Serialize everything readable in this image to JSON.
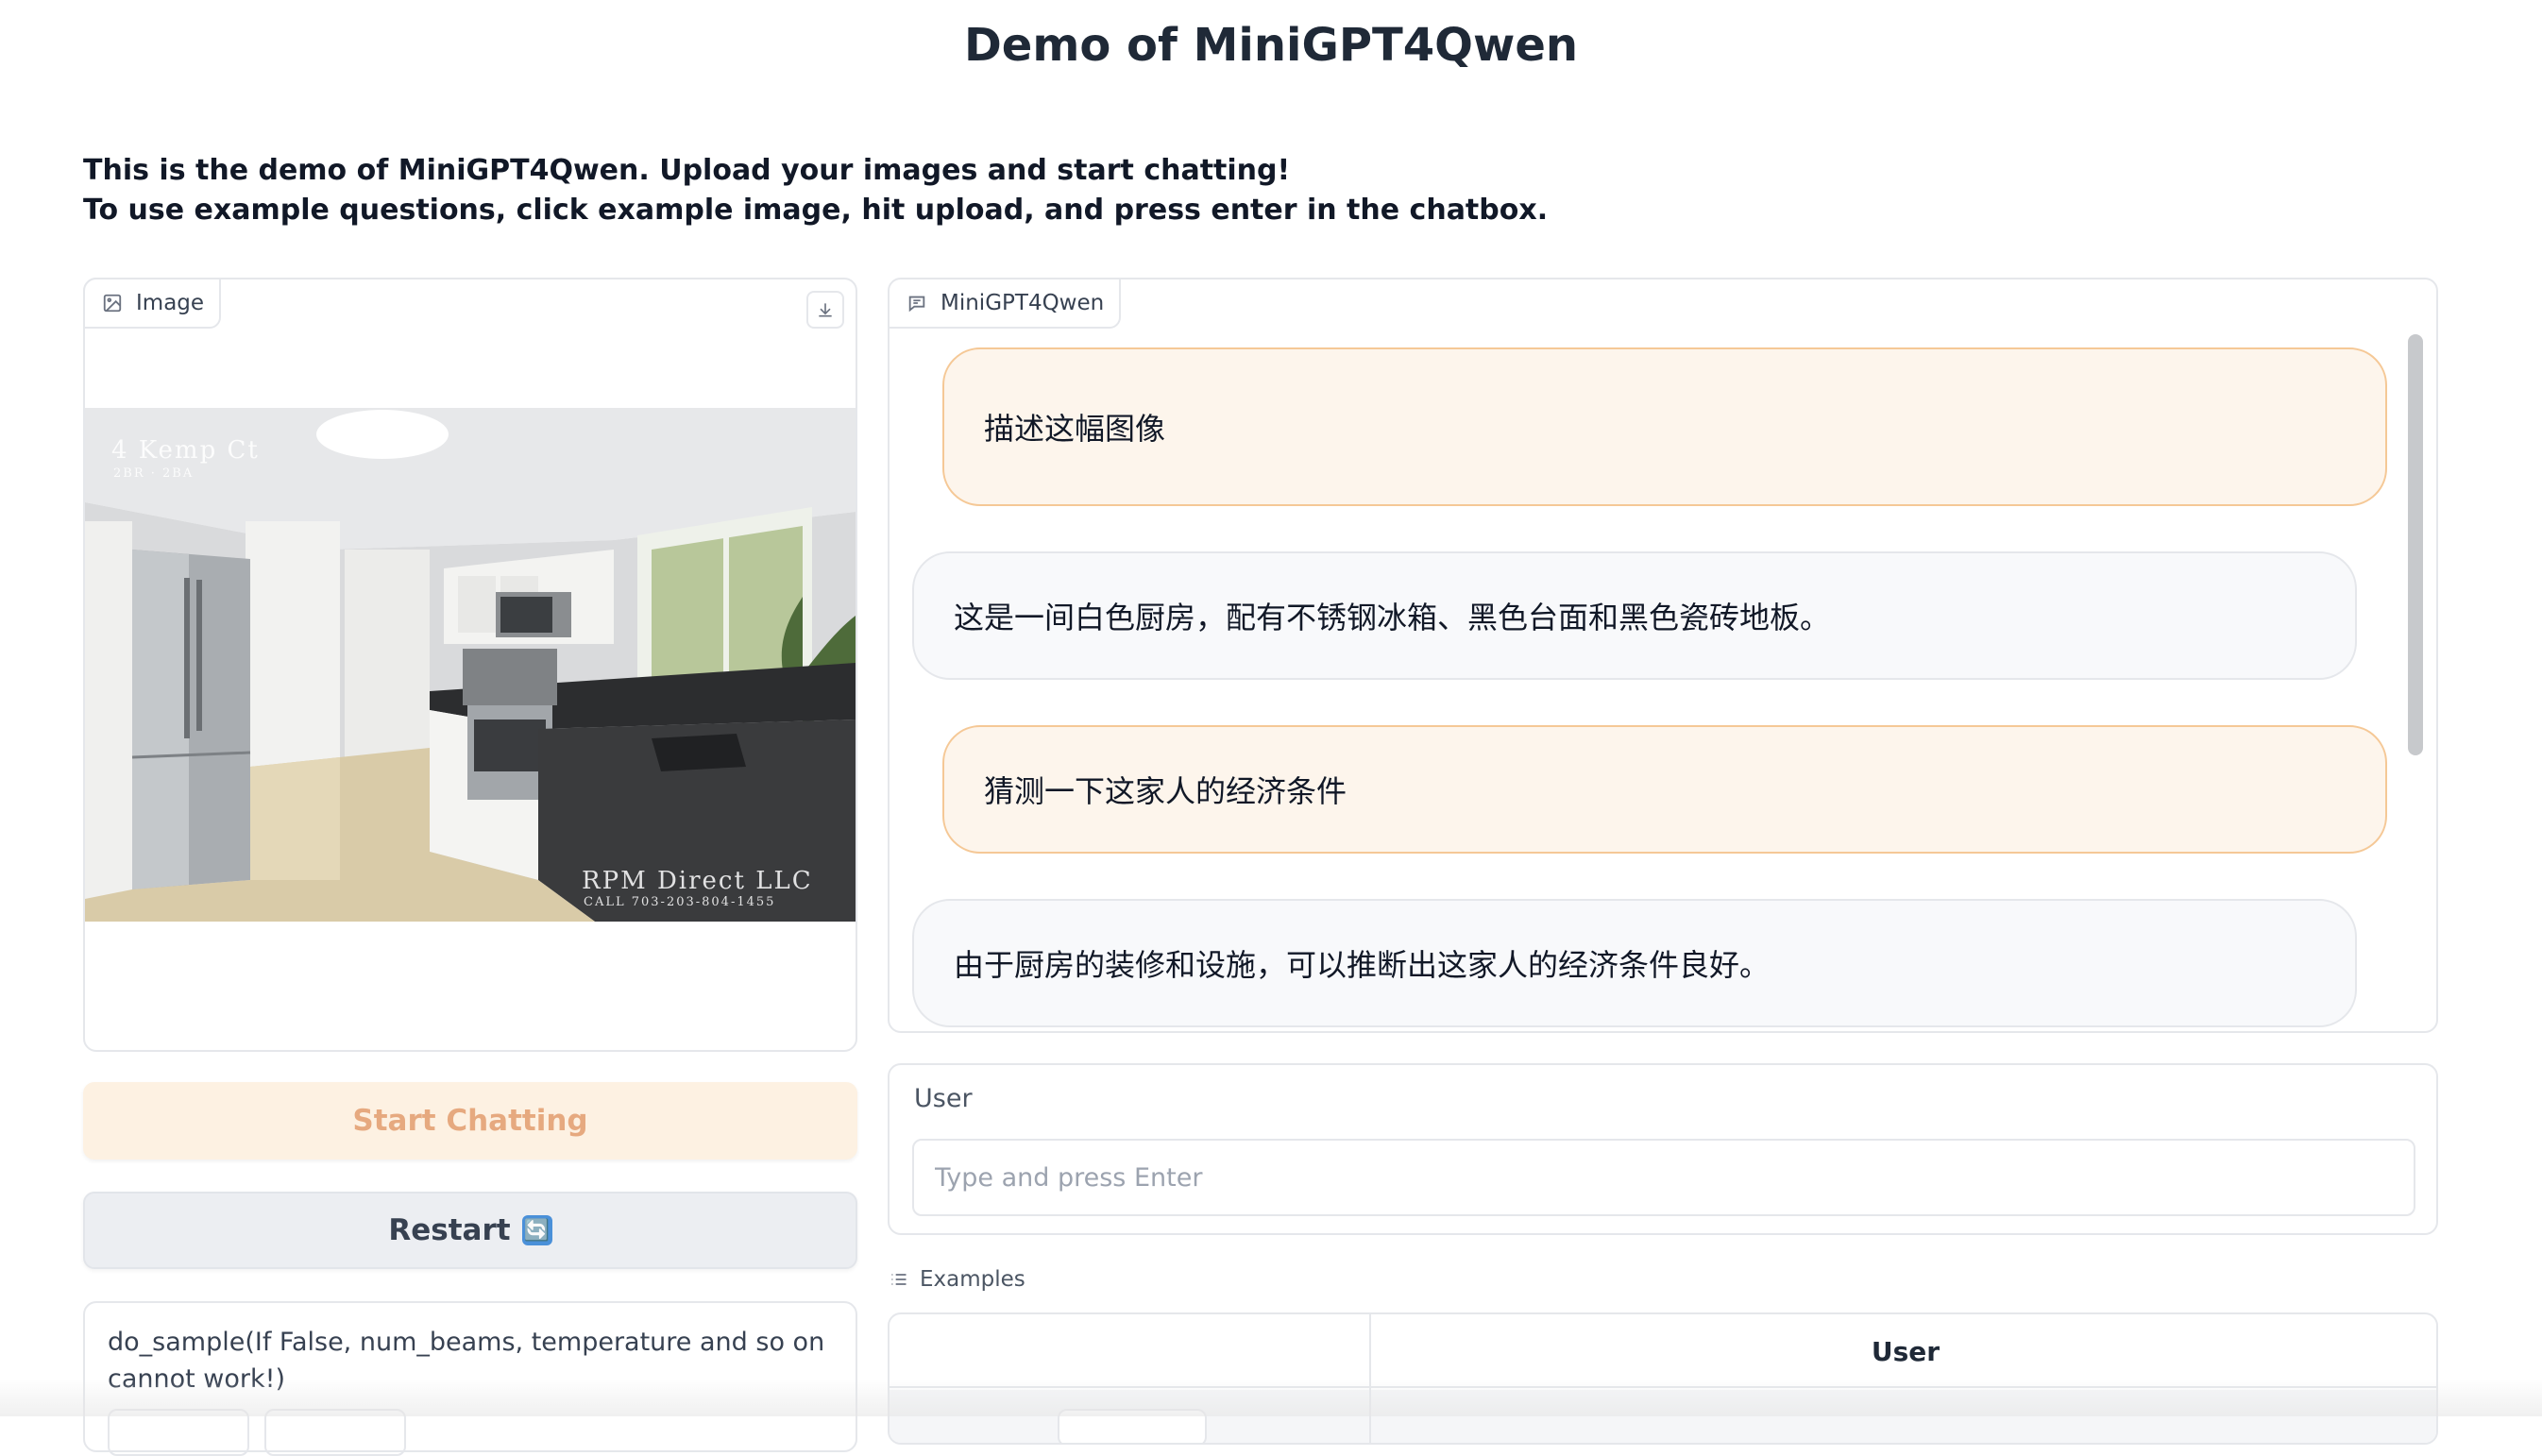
{
  "page": {
    "title": "Demo of MiniGPT4Qwen",
    "intro_line1": "This is the demo of MiniGPT4Qwen. Upload your images and start chatting!",
    "intro_line2": "To use example questions, click example image, hit upload, and press enter in the chatbox."
  },
  "image_panel": {
    "label": "Image",
    "label_icon": "image-icon",
    "download_icon": "download-icon",
    "watermark_top": "4 Kemp Ct",
    "watermark_top_sub": "2BR · 2BA",
    "watermark_bottom": "RPM Direct LLC",
    "watermark_bottom_sub": "CALL 703-203-804-1455"
  },
  "buttons": {
    "start": "Start Chatting",
    "restart": "Restart",
    "restart_emoji": "🔄"
  },
  "sampling": {
    "label": "do_sample(If False, num_beams, temperature and so on cannot work!)"
  },
  "chat": {
    "label": "MiniGPT4Qwen",
    "label_icon": "chat-icon",
    "messages": [
      {
        "role": "user",
        "text": "描述这幅图像"
      },
      {
        "role": "bot",
        "text": "这是一间白色厨房，配有不锈钢冰箱、黑色台面和黑色瓷砖地板。"
      },
      {
        "role": "user",
        "text": "猜测一下这家人的经济条件"
      },
      {
        "role": "bot",
        "text": "由于厨房的装修和设施，可以推断出这家人的经济条件良好。"
      }
    ]
  },
  "user_input": {
    "label": "User",
    "placeholder": "Type and press Enter",
    "value": ""
  },
  "examples": {
    "label": "Examples",
    "label_icon": "list-icon",
    "columns": [
      "",
      "User"
    ]
  },
  "colors": {
    "accent": "#f5c896",
    "user_bubble_bg": "#fdf5ec",
    "start_button_bg": "#fdf1e2",
    "start_button_text": "#e6a97f"
  }
}
